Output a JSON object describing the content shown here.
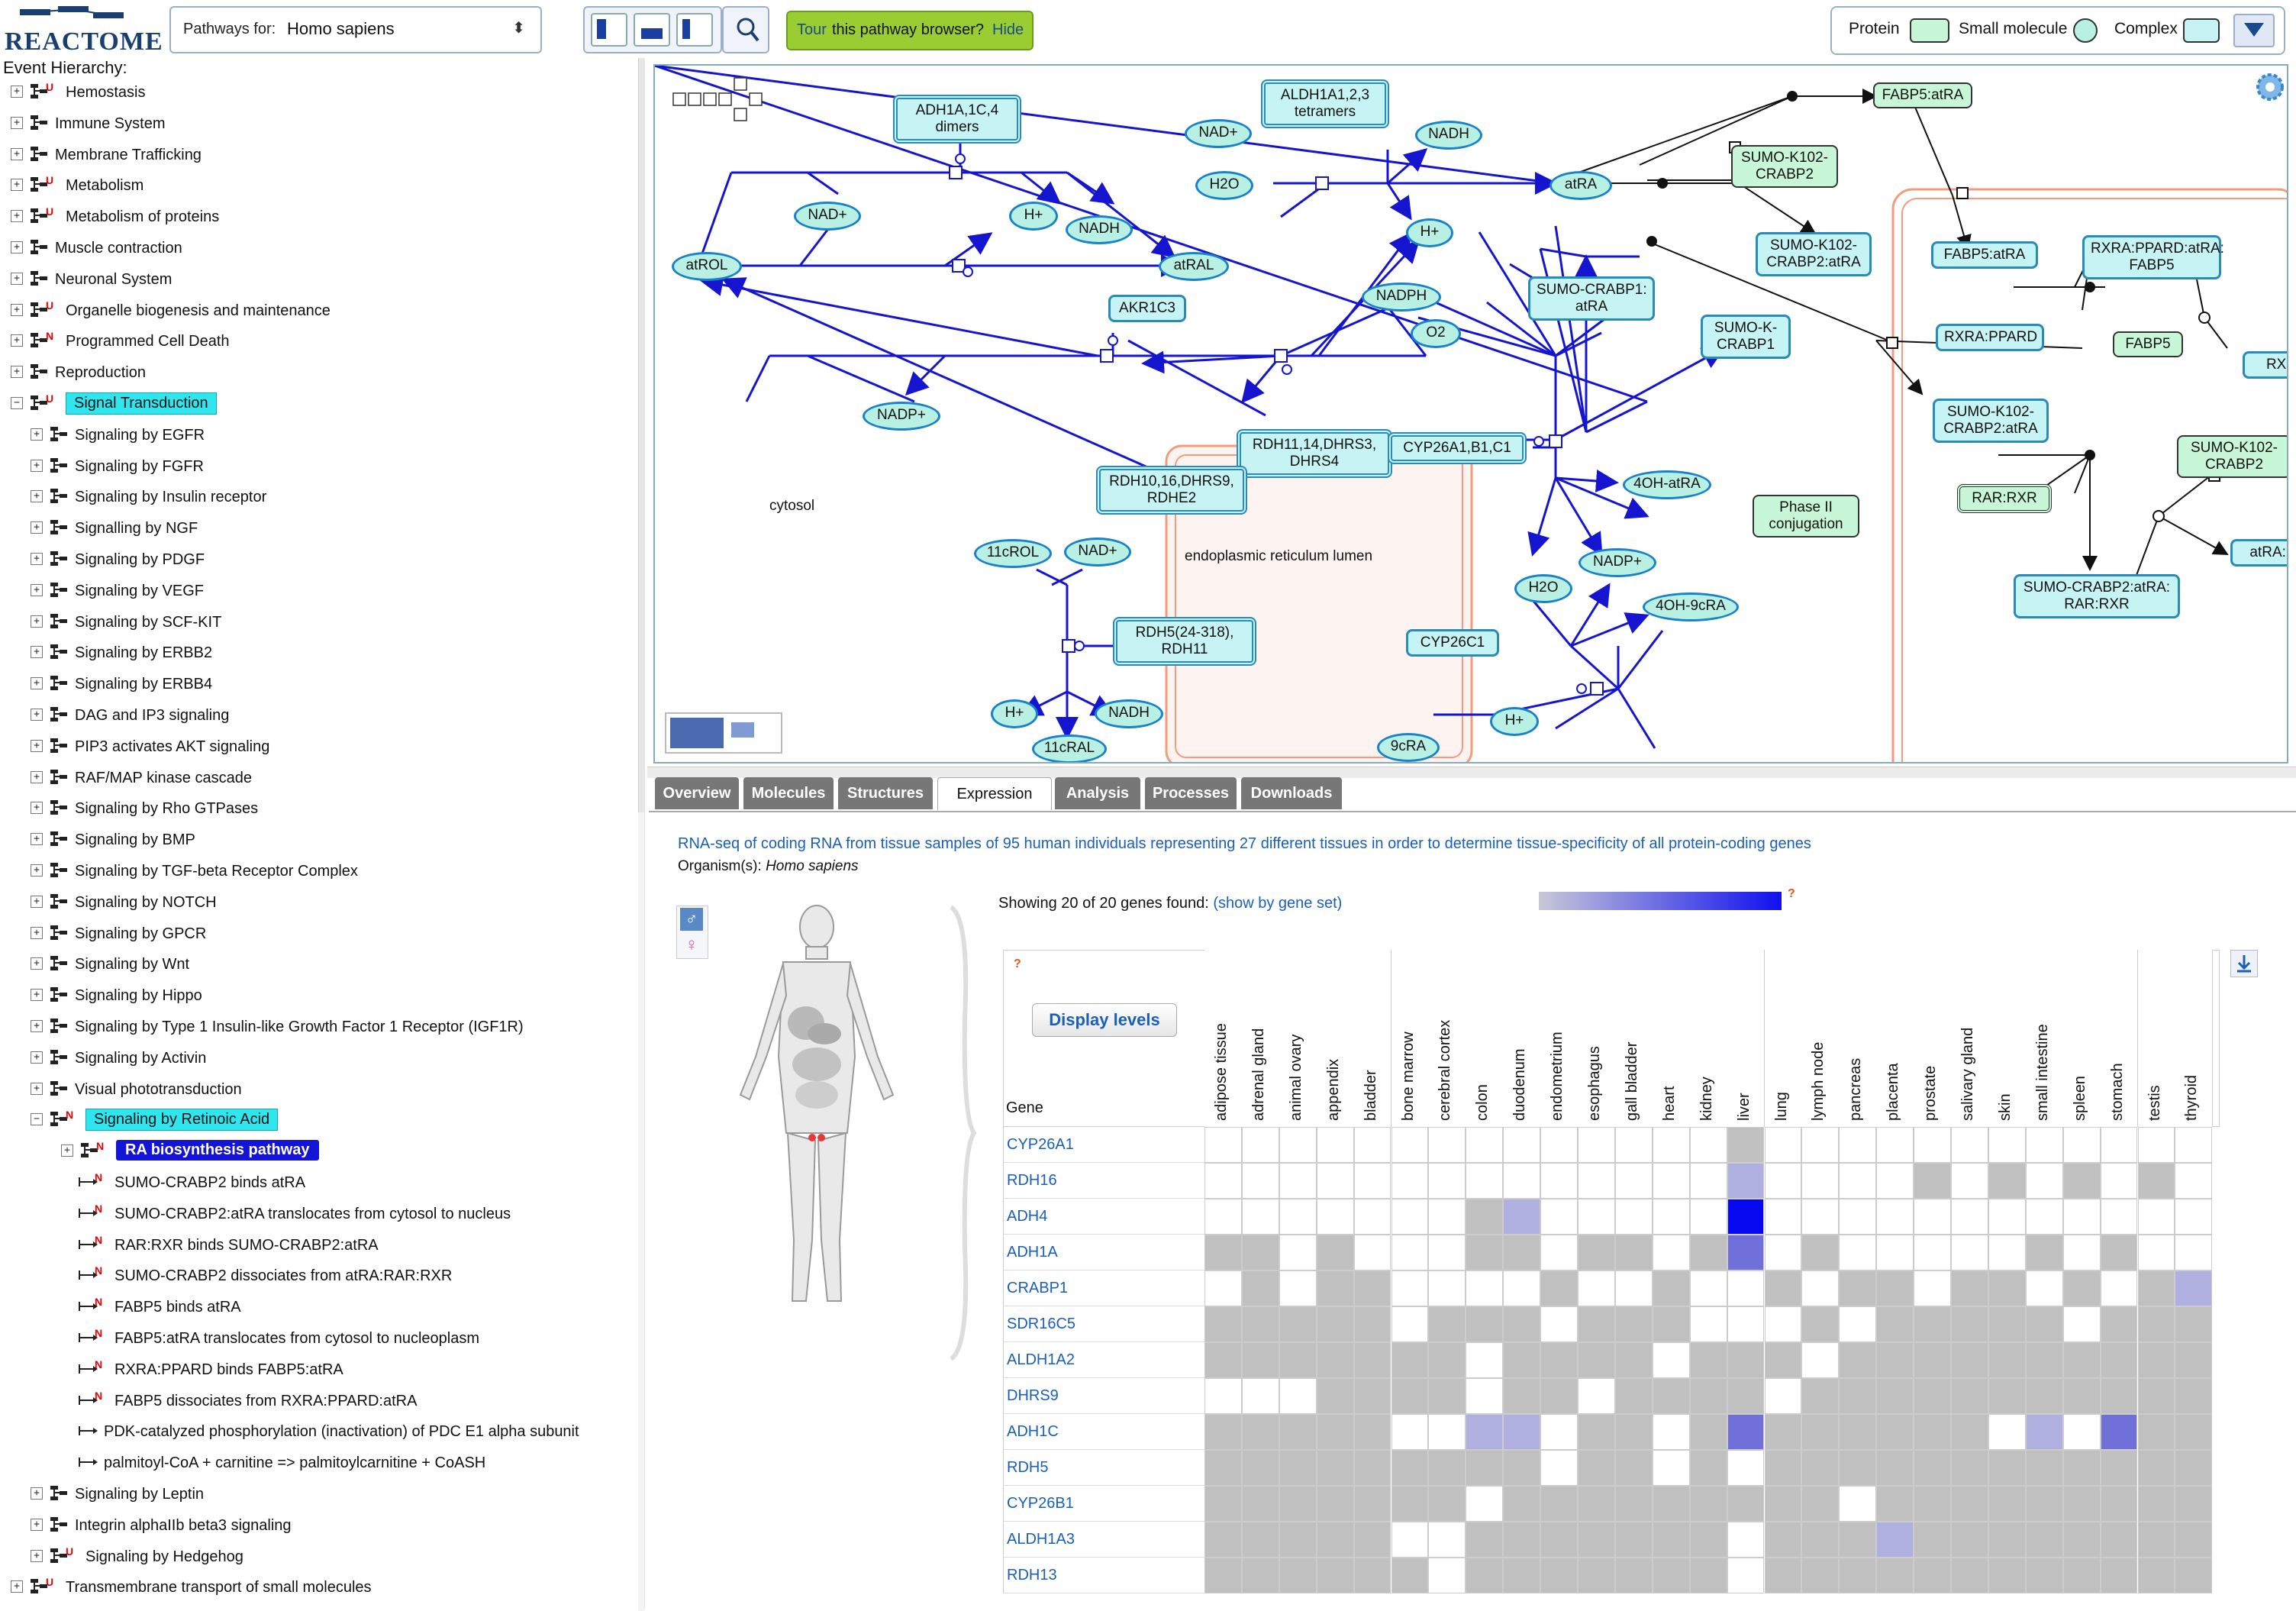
{
  "header": {
    "logo_text": "REACTOME",
    "species_label": "Pathways for:",
    "species_value": "Homo sapiens",
    "tour_text": "Tour",
    "tour_rest": "this pathway browser?",
    "tour_hide": "Hide",
    "legend": {
      "protein": "Protein",
      "small_molecule": "Small molecule",
      "complex": "Complex"
    }
  },
  "hierarchy": {
    "title": "Event Hierarchy:",
    "items": [
      {
        "label": "Hemostasis",
        "flag": "U",
        "lvl": 0
      },
      {
        "label": "Immune System",
        "flag": "",
        "lvl": 0
      },
      {
        "label": "Membrane Trafficking",
        "flag": "",
        "lvl": 0
      },
      {
        "label": "Metabolism",
        "flag": "U",
        "lvl": 0
      },
      {
        "label": "Metabolism of proteins",
        "flag": "U",
        "lvl": 0
      },
      {
        "label": "Muscle contraction",
        "flag": "",
        "lvl": 0
      },
      {
        "label": "Neuronal System",
        "flag": "",
        "lvl": 0
      },
      {
        "label": "Organelle biogenesis and maintenance",
        "flag": "U",
        "lvl": 0
      },
      {
        "label": "Programmed Cell Death",
        "flag": "N",
        "lvl": 0
      },
      {
        "label": "Reproduction",
        "flag": "",
        "lvl": 0
      },
      {
        "label": "Signal Transduction",
        "flag": "U",
        "lvl": 0,
        "hl": true,
        "open": true
      },
      {
        "label": "Signaling by EGFR",
        "flag": "",
        "lvl": 1
      },
      {
        "label": "Signaling by FGFR",
        "flag": "",
        "lvl": 1
      },
      {
        "label": "Signaling by Insulin receptor",
        "flag": "",
        "lvl": 1
      },
      {
        "label": "Signalling by NGF",
        "flag": "",
        "lvl": 1
      },
      {
        "label": "Signaling by PDGF",
        "flag": "",
        "lvl": 1
      },
      {
        "label": "Signaling by VEGF",
        "flag": "",
        "lvl": 1
      },
      {
        "label": "Signaling by SCF-KIT",
        "flag": "",
        "lvl": 1
      },
      {
        "label": "Signaling by ERBB2",
        "flag": "",
        "lvl": 1
      },
      {
        "label": "Signaling by ERBB4",
        "flag": "",
        "lvl": 1
      },
      {
        "label": "DAG and IP3 signaling",
        "flag": "",
        "lvl": 1
      },
      {
        "label": "PIP3 activates AKT signaling",
        "flag": "",
        "lvl": 1
      },
      {
        "label": "RAF/MAP kinase cascade",
        "flag": "",
        "lvl": 1
      },
      {
        "label": "Signaling by Rho GTPases",
        "flag": "",
        "lvl": 1
      },
      {
        "label": "Signaling by BMP",
        "flag": "",
        "lvl": 1
      },
      {
        "label": "Signaling by TGF-beta Receptor Complex",
        "flag": "",
        "lvl": 1
      },
      {
        "label": "Signaling by NOTCH",
        "flag": "",
        "lvl": 1
      },
      {
        "label": "Signaling by GPCR",
        "flag": "",
        "lvl": 1
      },
      {
        "label": "Signaling by Wnt",
        "flag": "",
        "lvl": 1
      },
      {
        "label": "Signaling by Hippo",
        "flag": "",
        "lvl": 1
      },
      {
        "label": "Signaling by Type 1 Insulin-like Growth Factor 1 Receptor (IGF1R)",
        "flag": "",
        "lvl": 1
      },
      {
        "label": "Signaling by Activin",
        "flag": "",
        "lvl": 1
      },
      {
        "label": "Visual phototransduction",
        "flag": "",
        "lvl": 1
      },
      {
        "label": "Signaling by Retinoic Acid",
        "flag": "N",
        "lvl": 1,
        "hl": true,
        "open": true
      },
      {
        "label": "RA biosynthesis pathway",
        "flag": "N",
        "lvl": 2,
        "sel": true
      },
      {
        "label": "SUMO-CRABP2 binds atRA",
        "flag": "N",
        "lvl": 3,
        "rx": true
      },
      {
        "label": "SUMO-CRABP2:atRA translocates from cytosol to nucleus",
        "flag": "N",
        "lvl": 3,
        "rx": true
      },
      {
        "label": "RAR:RXR binds SUMO-CRABP2:atRA",
        "flag": "N",
        "lvl": 3,
        "rx": true
      },
      {
        "label": "SUMO-CRABP2 dissociates from atRA:RAR:RXR",
        "flag": "N",
        "lvl": 3,
        "rx": true
      },
      {
        "label": "FABP5 binds atRA",
        "flag": "N",
        "lvl": 3,
        "rx": true
      },
      {
        "label": "FABP5:atRA translocates from cytosol to nucleoplasm",
        "flag": "N",
        "lvl": 3,
        "rx": true
      },
      {
        "label": "RXRA:PPARD binds FABP5:atRA",
        "flag": "N",
        "lvl": 3,
        "rx": true
      },
      {
        "label": "FABP5 dissociates from RXRA:PPARD:atRA",
        "flag": "N",
        "lvl": 3,
        "rx": true
      },
      {
        "label": "PDK-catalyzed phosphorylation (inactivation) of PDC E1 alpha subunit",
        "flag": "",
        "lvl": 3,
        "rx": true
      },
      {
        "label": "palmitoyl-CoA + carnitine => palmitoylcarnitine + CoASH",
        "flag": "",
        "lvl": 3,
        "rx": true
      },
      {
        "label": "Signaling by Leptin",
        "flag": "",
        "lvl": 1
      },
      {
        "label": "Integrin alphaIIb beta3 signaling",
        "flag": "",
        "lvl": 1
      },
      {
        "label": "Signaling by Hedgehog",
        "flag": "U",
        "lvl": 1
      },
      {
        "label": "Transmembrane transport of small molecules",
        "flag": "U",
        "lvl": 0
      }
    ]
  },
  "diagram": {
    "compartments": {
      "cytosol": "cytosol",
      "er": "endoplasmic reticulum lumen"
    },
    "nodes": [
      {
        "t": "cx",
        "l": "ADH1A,1C,4\ndimers"
      },
      {
        "t": "cx",
        "l": "ALDH1A1,2,3\ntetramers"
      },
      {
        "t": "sm",
        "l": "NAD+"
      },
      {
        "t": "sm",
        "l": "NADH"
      },
      {
        "t": "sm",
        "l": "H2O"
      },
      {
        "t": "sm",
        "l": "NAD+"
      },
      {
        "t": "sm",
        "l": "H+"
      },
      {
        "t": "sm",
        "l": "NADH"
      },
      {
        "t": "sm",
        "l": "atROL"
      },
      {
        "t": "sm",
        "l": "atRAL"
      },
      {
        "t": "sm",
        "l": "atRA"
      },
      {
        "t": "sm",
        "l": "H+"
      },
      {
        "t": "cx",
        "l": "AKR1C3"
      },
      {
        "t": "sm",
        "l": "NADPH"
      },
      {
        "t": "sm",
        "l": "O2"
      },
      {
        "t": "sm",
        "l": "NADP+"
      },
      {
        "t": "cx",
        "l": "SUMO-CRABP1:\natRA"
      },
      {
        "t": "cx",
        "l": "SUMO-K-\nCRABP1"
      },
      {
        "t": "cx",
        "l": "RDH11,14,DHRS3,\nDHRS4"
      },
      {
        "t": "cx",
        "l": "CYP26A1,B1,C1"
      },
      {
        "t": "cx",
        "l": "RDH10,16,DHRS9,\nRDHE2"
      },
      {
        "t": "sm",
        "l": "4OH-atRA"
      },
      {
        "t": "sm",
        "l": "11cROL"
      },
      {
        "t": "sm",
        "l": "NAD+"
      },
      {
        "t": "sm",
        "l": "NADP+"
      },
      {
        "t": "sm",
        "l": "H2O"
      },
      {
        "t": "cx",
        "l": "RDH5(24-318),\nRDH11"
      },
      {
        "t": "cx",
        "l": "CYP26C1"
      },
      {
        "t": "sm",
        "l": "4OH-9cRA"
      },
      {
        "t": "sm",
        "l": "H+"
      },
      {
        "t": "sm",
        "l": "NADH"
      },
      {
        "t": "sm",
        "l": "11cRAL"
      },
      {
        "t": "sm",
        "l": "H+"
      },
      {
        "t": "sm",
        "l": "9cRA"
      },
      {
        "t": "pr",
        "l": "Phase II\nconjugation"
      },
      {
        "t": "pr",
        "l": "FABP5:atRA"
      },
      {
        "t": "pr",
        "l": "SUMO-K102-\nCRABP2"
      },
      {
        "t": "cx",
        "l": "SUMO-K102-\nCRABP2:atRA"
      },
      {
        "t": "cx",
        "l": "FABP5:atRA"
      },
      {
        "t": "cx",
        "l": "RXRA:PPARD:atRA:\nFABP5"
      },
      {
        "t": "cx",
        "l": "RXRA:PPARD"
      },
      {
        "t": "pr",
        "l": "FABP5"
      },
      {
        "t": "cx",
        "l": "RXR"
      },
      {
        "t": "cx",
        "l": "SUMO-K102-\nCRABP2:atRA"
      },
      {
        "t": "pr",
        "l": "RAR:RXR"
      },
      {
        "t": "pr",
        "l": "SUMO-K102-\nCRABP2"
      },
      {
        "t": "cx",
        "l": "atRA:R"
      },
      {
        "t": "cx",
        "l": "SUMO-CRABP2:atRA:\nRAR:RXR"
      }
    ]
  },
  "tabs": [
    "Overview",
    "Molecules",
    "Structures",
    "Expression",
    "Analysis",
    "Processes",
    "Downloads"
  ],
  "active_tab": "Expression",
  "expression": {
    "description": "RNA-seq of coding RNA from tissue samples of 95 human individuals representing 27 different tissues in order to determine tissue-specificity of all protein-coding genes",
    "organism_label": "Organism(s):",
    "organism": "Homo sapiens",
    "showing": "Showing 20 of 20 genes found:",
    "show_by_gene_set": "(show by gene set)",
    "display_levels": "Display levels",
    "gene_header": "Gene",
    "help_mark": "?",
    "tissues": [
      "adipose tissue",
      "adrenal gland",
      "animal ovary",
      "appendix",
      "bladder",
      "bone marrow",
      "cerebral cortex",
      "colon",
      "duodenum",
      "endometrium",
      "esophagus",
      "gall bladder",
      "heart",
      "kidney",
      "liver",
      "lung",
      "lymph node",
      "pancreas",
      "placenta",
      "prostate",
      "salivary gland",
      "skin",
      "small intestine",
      "spleen",
      "stomach",
      "testis",
      "thyroid"
    ],
    "genes": [
      "CYP26A1",
      "RDH16",
      "ADH4",
      "ADH1A",
      "CRABP1",
      "SDR16C5",
      "ALDH1A2",
      "DHRS9",
      "ADH1C",
      "RDH5",
      "CYP26B1",
      "ALDH1A3",
      "RDH13"
    ],
    "levels": [
      [
        0,
        0,
        0,
        0,
        0,
        0,
        0,
        0,
        0,
        0,
        0,
        0,
        0,
        0,
        1,
        0,
        0,
        0,
        0,
        0,
        0,
        0,
        0,
        0,
        0,
        0,
        0
      ],
      [
        0,
        0,
        0,
        0,
        0,
        0,
        0,
        0,
        0,
        0,
        0,
        0,
        0,
        0,
        2,
        0,
        0,
        0,
        0,
        1,
        0,
        1,
        0,
        1,
        0,
        1,
        0
      ],
      [
        0,
        0,
        0,
        0,
        0,
        0,
        0,
        1,
        2,
        0,
        0,
        0,
        0,
        0,
        4,
        0,
        0,
        0,
        0,
        0,
        0,
        0,
        0,
        0,
        0,
        0,
        0
      ],
      [
        1,
        1,
        0,
        1,
        0,
        0,
        0,
        1,
        1,
        0,
        1,
        1,
        0,
        1,
        3,
        0,
        1,
        0,
        0,
        0,
        0,
        0,
        1,
        0,
        1,
        0,
        0
      ],
      [
        0,
        1,
        0,
        1,
        1,
        0,
        0,
        0,
        0,
        1,
        0,
        0,
        1,
        0,
        0,
        1,
        0,
        1,
        1,
        0,
        1,
        1,
        0,
        1,
        0,
        1,
        2
      ],
      [
        1,
        1,
        1,
        1,
        1,
        0,
        1,
        1,
        1,
        0,
        1,
        1,
        1,
        0,
        0,
        0,
        1,
        0,
        1,
        1,
        1,
        1,
        1,
        0,
        1,
        1,
        1
      ],
      [
        1,
        1,
        1,
        1,
        1,
        1,
        1,
        0,
        1,
        1,
        1,
        1,
        0,
        1,
        1,
        1,
        0,
        1,
        1,
        1,
        1,
        1,
        1,
        1,
        1,
        1,
        1
      ],
      [
        0,
        0,
        0,
        1,
        1,
        1,
        1,
        0,
        1,
        1,
        0,
        1,
        1,
        1,
        1,
        0,
        1,
        1,
        1,
        1,
        1,
        1,
        1,
        1,
        1,
        1,
        1
      ],
      [
        1,
        1,
        1,
        1,
        1,
        0,
        0,
        2,
        2,
        0,
        1,
        1,
        0,
        1,
        3,
        1,
        1,
        1,
        1,
        1,
        1,
        0,
        2,
        0,
        3,
        1,
        1
      ],
      [
        1,
        1,
        1,
        1,
        1,
        1,
        1,
        1,
        1,
        0,
        1,
        1,
        0,
        1,
        0,
        1,
        1,
        1,
        1,
        1,
        1,
        1,
        1,
        1,
        1,
        1,
        1
      ],
      [
        1,
        1,
        1,
        1,
        1,
        1,
        1,
        0,
        1,
        1,
        1,
        1,
        1,
        1,
        1,
        1,
        1,
        0,
        1,
        1,
        1,
        1,
        1,
        1,
        1,
        1,
        1
      ],
      [
        1,
        1,
        1,
        1,
        1,
        0,
        0,
        1,
        1,
        1,
        1,
        1,
        1,
        1,
        0,
        1,
        1,
        1,
        2,
        1,
        1,
        1,
        1,
        1,
        1,
        1,
        1
      ],
      [
        1,
        1,
        1,
        1,
        1,
        1,
        0,
        1,
        1,
        1,
        1,
        1,
        1,
        1,
        0,
        1,
        1,
        1,
        1,
        1,
        1,
        1,
        1,
        1,
        1,
        1,
        1
      ]
    ]
  },
  "colors": {
    "expr0": "#ffffff",
    "expr1": "#c0c0c0",
    "expr2": "#b0b0e0",
    "expr3": "#7070d8",
    "expr4": "#0808f0",
    "link": "#1a5fb8",
    "edge": "#1515d0"
  }
}
